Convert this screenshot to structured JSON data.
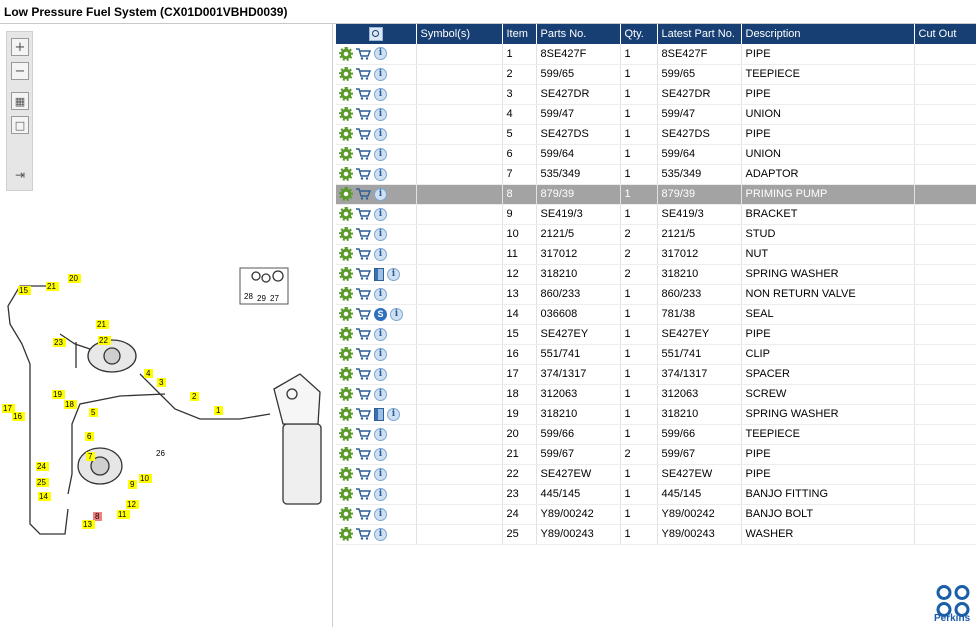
{
  "window": {
    "title": "Low Pressure Fuel System (CX01D001VBHD0039)"
  },
  "toolbar": {
    "zoom_in_icon": "plus-icon",
    "zoom_out_icon": "minus-icon",
    "fit_icon": "grid-icon",
    "actual_icon": "square-icon",
    "export_icon": "export-icon"
  },
  "diagram": {
    "callouts": [
      "1",
      "2",
      "3",
      "4",
      "5",
      "6",
      "7",
      "8",
      "9",
      "10",
      "11",
      "12",
      "13",
      "14",
      "15",
      "16",
      "17",
      "18",
      "19",
      "20",
      "21",
      "22",
      "23",
      "24",
      "25",
      "26",
      "27",
      "28",
      "29"
    ],
    "highlight_color": "#ffff00",
    "selected_color": "#f08080"
  },
  "grid": {
    "columns": [
      "",
      "Symbol(s)",
      "Item",
      "Parts No.",
      "Qty.",
      "Latest Part No.",
      "Description",
      "Cut Out"
    ],
    "header_color": "#173f73",
    "selected_row_color": "#a3a3a3",
    "rows": [
      {
        "item": "1",
        "part": "8SE427F",
        "qty": "1",
        "latest": "8SE427F",
        "desc": "PIPE",
        "extra": ""
      },
      {
        "item": "2",
        "part": "599/65",
        "qty": "1",
        "latest": "599/65",
        "desc": "TEEPIECE",
        "extra": ""
      },
      {
        "item": "3",
        "part": "SE427DR",
        "qty": "1",
        "latest": "SE427DR",
        "desc": "PIPE",
        "extra": ""
      },
      {
        "item": "4",
        "part": "599/47",
        "qty": "1",
        "latest": "599/47",
        "desc": "UNION",
        "extra": ""
      },
      {
        "item": "5",
        "part": "SE427DS",
        "qty": "1",
        "latest": "SE427DS",
        "desc": "PIPE",
        "extra": ""
      },
      {
        "item": "6",
        "part": "599/64",
        "qty": "1",
        "latest": "599/64",
        "desc": "UNION",
        "extra": ""
      },
      {
        "item": "7",
        "part": "535/349",
        "qty": "1",
        "latest": "535/349",
        "desc": "ADAPTOR",
        "extra": ""
      },
      {
        "item": "8",
        "part": "879/39",
        "qty": "1",
        "latest": "879/39",
        "desc": "PRIMING PUMP",
        "extra": "",
        "selected": true
      },
      {
        "item": "9",
        "part": "SE419/3",
        "qty": "1",
        "latest": "SE419/3",
        "desc": "BRACKET",
        "extra": ""
      },
      {
        "item": "10",
        "part": "2121/5",
        "qty": "2",
        "latest": "2121/5",
        "desc": "STUD",
        "extra": ""
      },
      {
        "item": "11",
        "part": "317012",
        "qty": "2",
        "latest": "317012",
        "desc": "NUT",
        "extra": ""
      },
      {
        "item": "12",
        "part": "318210",
        "qty": "2",
        "latest": "318210",
        "desc": "SPRING WASHER",
        "extra": "book"
      },
      {
        "item": "13",
        "part": "860/233",
        "qty": "1",
        "latest": "860/233",
        "desc": "NON RETURN VALVE",
        "extra": ""
      },
      {
        "item": "14",
        "part": "036608",
        "qty": "1",
        "latest": "781/38",
        "desc": "SEAL",
        "extra": "s"
      },
      {
        "item": "15",
        "part": "SE427EY",
        "qty": "1",
        "latest": "SE427EY",
        "desc": "PIPE",
        "extra": ""
      },
      {
        "item": "16",
        "part": "551/741",
        "qty": "1",
        "latest": "551/741",
        "desc": "CLIP",
        "extra": ""
      },
      {
        "item": "17",
        "part": "374/1317",
        "qty": "1",
        "latest": "374/1317",
        "desc": "SPACER",
        "extra": ""
      },
      {
        "item": "18",
        "part": "312063",
        "qty": "1",
        "latest": "312063",
        "desc": "SCREW",
        "extra": ""
      },
      {
        "item": "19",
        "part": "318210",
        "qty": "1",
        "latest": "318210",
        "desc": "SPRING WASHER",
        "extra": "book"
      },
      {
        "item": "20",
        "part": "599/66",
        "qty": "1",
        "latest": "599/66",
        "desc": "TEEPIECE",
        "extra": ""
      },
      {
        "item": "21",
        "part": "599/67",
        "qty": "2",
        "latest": "599/67",
        "desc": "PIPE",
        "extra": ""
      },
      {
        "item": "22",
        "part": "SE427EW",
        "qty": "1",
        "latest": "SE427EW",
        "desc": "PIPE",
        "extra": ""
      },
      {
        "item": "23",
        "part": "445/145",
        "qty": "1",
        "latest": "445/145",
        "desc": "BANJO FITTING",
        "extra": ""
      },
      {
        "item": "24",
        "part": "Y89/00242",
        "qty": "1",
        "latest": "Y89/00242",
        "desc": "BANJO BOLT",
        "extra": ""
      },
      {
        "item": "25",
        "part": "Y89/00243",
        "qty": "1",
        "latest": "Y89/00243",
        "desc": "WASHER",
        "extra": ""
      }
    ]
  },
  "brand": {
    "name": "Perkins",
    "color": "#1b5ea8"
  }
}
